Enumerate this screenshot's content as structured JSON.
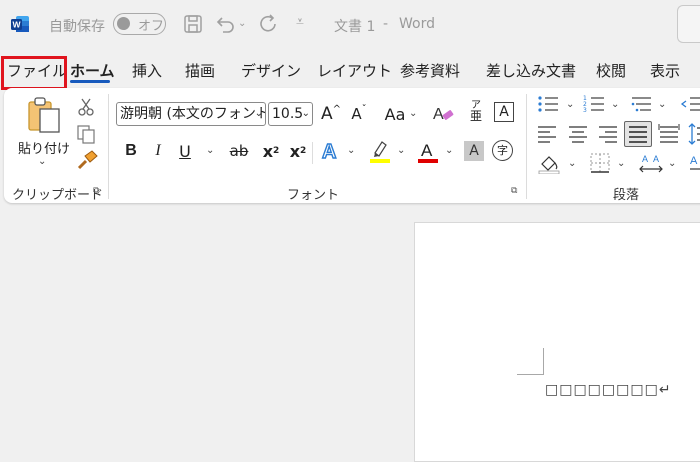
{
  "titlebar": {
    "autosave_label": "自動保存",
    "autosave_state": "オフ",
    "document_title": "文書 1",
    "separator": "-",
    "app_name": "Word"
  },
  "tabs": [
    {
      "label": "ファイル"
    },
    {
      "label": "ホーム"
    },
    {
      "label": "挿入"
    },
    {
      "label": "描画"
    },
    {
      "label": "デザイン"
    },
    {
      "label": "レイアウト"
    },
    {
      "label": "参考資料"
    },
    {
      "label": "差し込み文書"
    },
    {
      "label": "校閲"
    },
    {
      "label": "表示"
    }
  ],
  "clipboard": {
    "paste_label": "貼り付け",
    "group_label": "クリップボード"
  },
  "font": {
    "font_name": "游明朝 (本文のフォント",
    "font_size": "10.5",
    "group_label": "フォント",
    "change_case": "Aa",
    "phonetic_top": "ア",
    "phonetic_bottom": "亜",
    "bold": "B",
    "italic": "I",
    "underline": "U",
    "strike": "ab",
    "subscript": "x",
    "sub_mark": "2",
    "superscript": "x",
    "sup_mark": "2",
    "enclose": "字",
    "highlight_color": "#ffff00",
    "font_color": "#e00000"
  },
  "paragraph": {
    "group_label": "段落"
  },
  "document": {
    "text": "□□□□□□□□↵"
  },
  "colors": {
    "accent": "#185abd",
    "file_highlight": "#e0141e"
  }
}
